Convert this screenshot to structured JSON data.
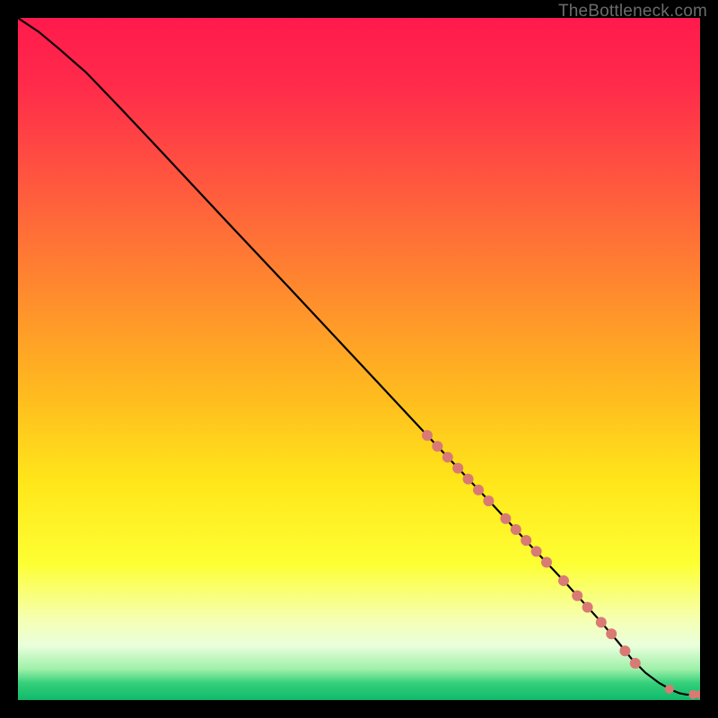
{
  "watermark": "TheBottleneck.com",
  "chart_data": {
    "type": "line",
    "title": "",
    "xlabel": "",
    "ylabel": "",
    "xlim": [
      0,
      100
    ],
    "ylim": [
      0,
      100
    ],
    "series": [
      {
        "name": "curve",
        "x": [
          0,
          3,
          6,
          10,
          15,
          20,
          30,
          40,
          50,
          60,
          65,
          70,
          75,
          80,
          85,
          88,
          90,
          92,
          94,
          96,
          97,
          98,
          100
        ],
        "y": [
          100,
          98,
          95.5,
          92,
          86.8,
          81.5,
          70.8,
          60.2,
          49.5,
          38.8,
          33.5,
          28.2,
          22.8,
          17.5,
          12,
          8.5,
          6,
          4,
          2.5,
          1.4,
          1.0,
          0.8,
          0.8
        ]
      }
    ],
    "markers": {
      "name": "highlighted-points",
      "color": "#d97a74",
      "points": [
        {
          "x": 60.0,
          "y": 38.8,
          "r": 6
        },
        {
          "x": 61.5,
          "y": 37.2,
          "r": 6
        },
        {
          "x": 63.0,
          "y": 35.6,
          "r": 6
        },
        {
          "x": 64.5,
          "y": 34.0,
          "r": 6
        },
        {
          "x": 66.0,
          "y": 32.4,
          "r": 6
        },
        {
          "x": 67.5,
          "y": 30.8,
          "r": 6
        },
        {
          "x": 69.0,
          "y": 29.2,
          "r": 6
        },
        {
          "x": 71.5,
          "y": 26.6,
          "r": 6
        },
        {
          "x": 73.0,
          "y": 25.0,
          "r": 6
        },
        {
          "x": 74.5,
          "y": 23.4,
          "r": 6
        },
        {
          "x": 76.0,
          "y": 21.8,
          "r": 6
        },
        {
          "x": 77.5,
          "y": 20.2,
          "r": 6
        },
        {
          "x": 80.0,
          "y": 17.5,
          "r": 6
        },
        {
          "x": 82.0,
          "y": 15.3,
          "r": 6
        },
        {
          "x": 83.5,
          "y": 13.6,
          "r": 6
        },
        {
          "x": 85.5,
          "y": 11.4,
          "r": 6
        },
        {
          "x": 87.0,
          "y": 9.7,
          "r": 6
        },
        {
          "x": 89.0,
          "y": 7.2,
          "r": 6
        },
        {
          "x": 90.5,
          "y": 5.4,
          "r": 6
        },
        {
          "x": 95.5,
          "y": 1.6,
          "r": 5
        },
        {
          "x": 99.0,
          "y": 0.8,
          "r": 5
        },
        {
          "x": 100.0,
          "y": 0.8,
          "r": 5
        }
      ]
    },
    "gradient_stops": [
      {
        "offset": 0.0,
        "color": "#ff1a4d"
      },
      {
        "offset": 0.1,
        "color": "#ff2b4a"
      },
      {
        "offset": 0.25,
        "color": "#ff5a3e"
      },
      {
        "offset": 0.4,
        "color": "#ff8a2e"
      },
      {
        "offset": 0.55,
        "color": "#ffba1f"
      },
      {
        "offset": 0.68,
        "color": "#ffe61a"
      },
      {
        "offset": 0.8,
        "color": "#fdff33"
      },
      {
        "offset": 0.88,
        "color": "#f6ffb0"
      },
      {
        "offset": 0.92,
        "color": "#eaffdc"
      },
      {
        "offset": 0.955,
        "color": "#9df0a8"
      },
      {
        "offset": 0.975,
        "color": "#35d07a"
      },
      {
        "offset": 1.0,
        "color": "#10b96b"
      }
    ]
  }
}
